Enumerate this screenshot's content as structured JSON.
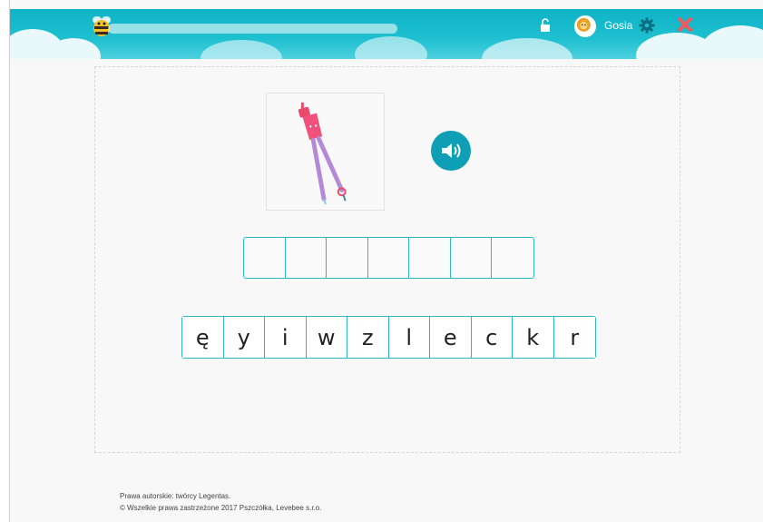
{
  "header": {
    "username": "Gosia",
    "progress": 0,
    "icons": {
      "logo": "bee-logo-icon",
      "lock": "unlock-icon",
      "settings": "gear-icon",
      "close": "close-icon"
    },
    "colors": {
      "header_bg": "#1ec0d0",
      "close": "#f05a5a",
      "gear": "#0a6f80"
    }
  },
  "exercise": {
    "picture_icon": "compass-drawing-tool-icon",
    "sound_icon": "speaker-icon",
    "answer_slots": 7,
    "letters": [
      "ę",
      "y",
      "i",
      "w",
      "z",
      "l",
      "e",
      "c",
      "k",
      "r"
    ],
    "accent": "#2fb6c6"
  },
  "footer": {
    "line1": "Prawa autorskie: twórcy Legentas.",
    "line2": "© Wszelkie prawa zastrzeżone 2017 Pszczółka, Levebee s.r.o."
  }
}
